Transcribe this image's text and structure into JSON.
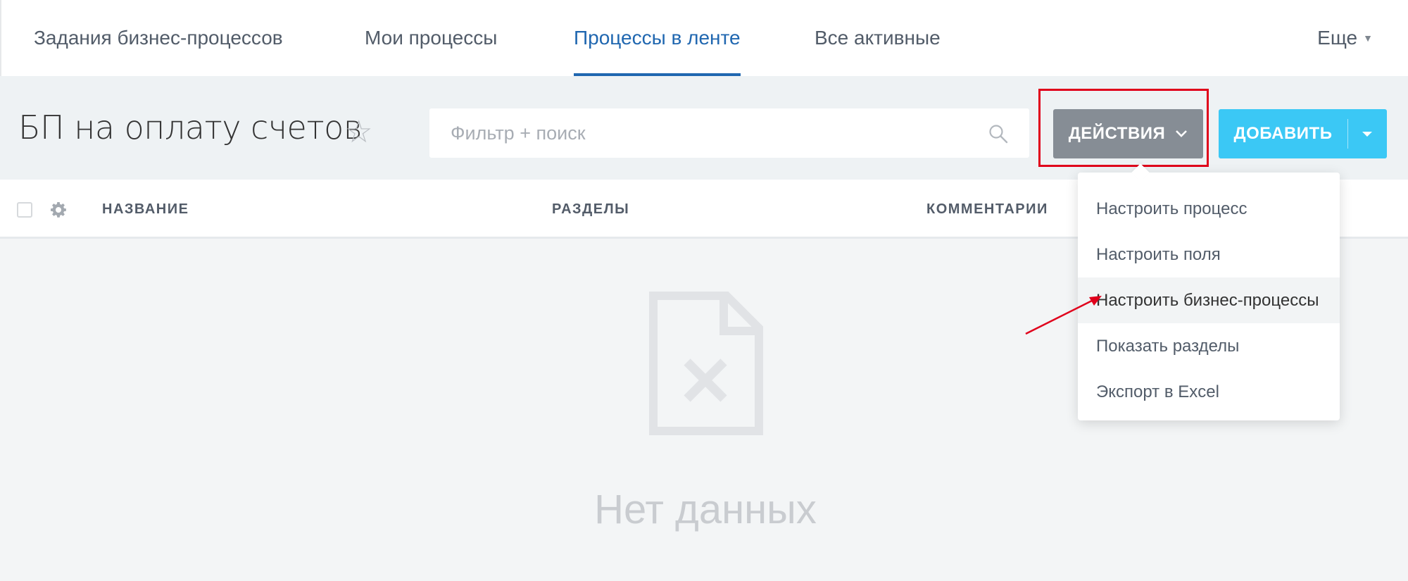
{
  "nav": {
    "tabs": [
      {
        "label": "Задания бизнес-процессов"
      },
      {
        "label": "Мои процессы"
      },
      {
        "label": "Процессы в ленте",
        "active": true
      },
      {
        "label": "Все активные"
      }
    ],
    "more_label": "Еще"
  },
  "header": {
    "title": "БП на оплату счетов",
    "search_placeholder": "Фильтр + поиск",
    "actions_label": "ДЕЙСТВИЯ",
    "add_label": "ДОБАВИТЬ"
  },
  "grid": {
    "columns": [
      "НАЗВАНИЕ",
      "РАЗДЕЛЫ",
      "КОММЕНТАРИИ"
    ],
    "empty_text": "Нет данных"
  },
  "actions_menu": {
    "items": [
      "Настроить процесс",
      "Настроить поля",
      "Настроить бизнес-процессы",
      "Показать разделы",
      "Экспорт в Excel"
    ],
    "highlighted_index": 2
  },
  "colors": {
    "accent": "#2067b0",
    "add_button": "#3bc8f5",
    "actions_button": "#868d95",
    "annotation": "#e0001b"
  },
  "icons": [
    "star-icon",
    "search-icon",
    "chevron-down-icon",
    "gear-icon",
    "empty-document-icon",
    "annotation-arrow"
  ]
}
